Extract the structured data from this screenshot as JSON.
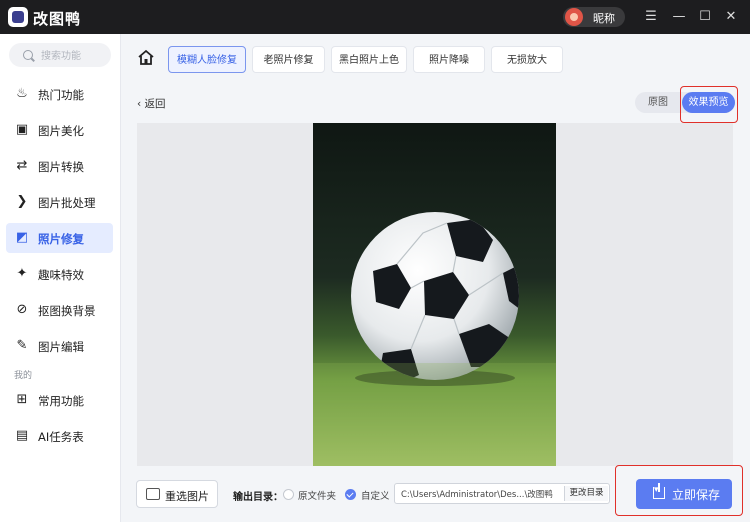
{
  "app": {
    "title": "改图鸭",
    "user_name": "昵称"
  },
  "window_controls": {
    "menu": "☰",
    "minimize": "—",
    "maximize": "☐",
    "close": "✕"
  },
  "sidebar": {
    "search_placeholder": "搜索功能",
    "items": [
      {
        "label": "热门功能",
        "icon": "flame-icon",
        "glyph": "♨"
      },
      {
        "label": "图片美化",
        "icon": "image-icon",
        "glyph": "▣"
      },
      {
        "label": "图片转换",
        "icon": "convert-icon",
        "glyph": "⇄"
      },
      {
        "label": "图片批处理",
        "icon": "batch-icon",
        "glyph": "❯"
      },
      {
        "label": "照片修复",
        "icon": "photo-repair-icon",
        "glyph": "◩"
      },
      {
        "label": "趣味特效",
        "icon": "sparkle-icon",
        "glyph": "✦"
      },
      {
        "label": "抠图换背景",
        "icon": "cutout-icon",
        "glyph": "⊘"
      },
      {
        "label": "图片编辑",
        "icon": "edit-image-icon",
        "glyph": "✎"
      }
    ],
    "section_mine": "我的",
    "mine_items": [
      {
        "label": "常用功能",
        "icon": "grid-icon",
        "glyph": "⊞"
      },
      {
        "label": "AI任务表",
        "icon": "task-list-icon",
        "glyph": "▤"
      }
    ],
    "active_index": 4
  },
  "tool_tabs": [
    "模糊人脸修复",
    "老照片修复",
    "黑白照片上色",
    "照片降噪",
    "无损放大"
  ],
  "active_tab": 0,
  "content": {
    "back_label": "返回",
    "view_original": "原图",
    "view_preview": "效果预览"
  },
  "bottom": {
    "reselect_label": "重选图片",
    "output_label": "输出目录：",
    "option_original": "原文件夹",
    "option_custom": "自定义",
    "output_path": "C:\\Users\\Administrator\\Des...\\改图鸭",
    "change_dir": "更改目录",
    "save_label": "立即保存"
  },
  "colors": {
    "accent": "#5b7cf1",
    "highlight": "#e0302a",
    "titlebar": "#1d1d1f"
  }
}
